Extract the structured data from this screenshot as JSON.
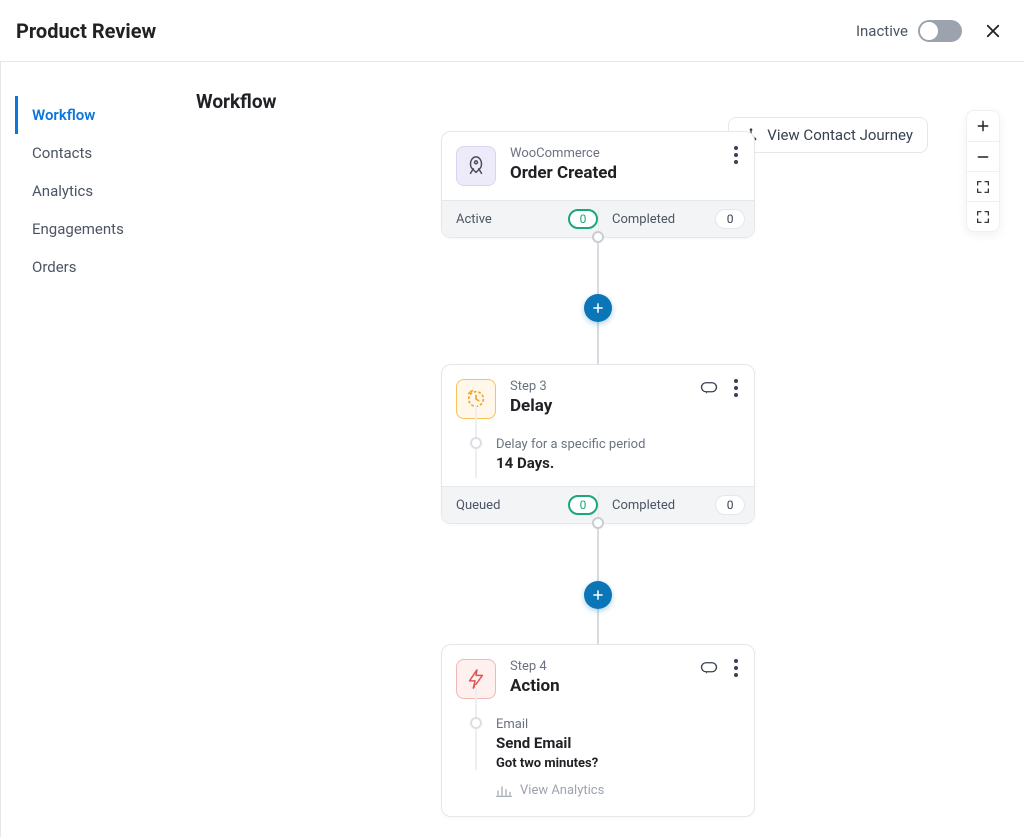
{
  "header": {
    "title": "Product Review",
    "status_label": "Inactive"
  },
  "sidebar": {
    "items": [
      {
        "label": "Workflow",
        "active": true
      },
      {
        "label": "Contacts"
      },
      {
        "label": "Analytics"
      },
      {
        "label": "Engagements"
      },
      {
        "label": "Orders"
      }
    ]
  },
  "main": {
    "section_title": "Workflow",
    "journey_button": "View Contact Journey"
  },
  "flow": {
    "trigger": {
      "eyebrow": "WooCommerce",
      "title": "Order Created",
      "foot_left_label": "Active",
      "foot_left_value": "0",
      "foot_right_label": "Completed",
      "foot_right_value": "0"
    },
    "delay": {
      "step_label": "Step 3",
      "title": "Delay",
      "detail_eyebrow": "Delay for a specific period",
      "detail_title": "14 Days.",
      "foot_left_label": "Queued",
      "foot_left_value": "0",
      "foot_right_label": "Completed",
      "foot_right_value": "0"
    },
    "action": {
      "step_label": "Step 4",
      "title": "Action",
      "detail_eyebrow": "Email",
      "detail_title": "Send Email",
      "detail_sub": "Got two minutes?",
      "analytics_label": "View Analytics"
    }
  }
}
